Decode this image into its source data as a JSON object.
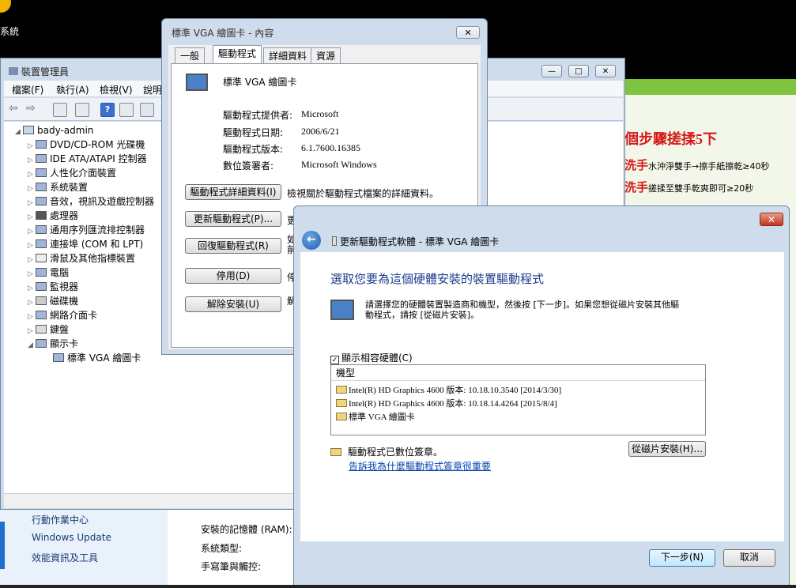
{
  "desktop": {
    "label": "系統"
  },
  "green_app": {
    "title": "個步驟搓揉5下",
    "line1_prefix": "洗手",
    "line1": "水沖淨雙手→擦手紙擦乾≥40秒",
    "line2_prefix": "洗手",
    "line2": "搓揉至雙手乾爽即可≥20秒"
  },
  "control_panel": {
    "links": [
      "行動作業中心",
      "Windows Update",
      "效能資訊及工具"
    ],
    "props": [
      "安裝的記憶體 (RAM):",
      "系統類型:",
      "手寫筆與觸控:"
    ]
  },
  "device_manager": {
    "title": "裝置管理員",
    "menu": [
      "檔案(F)",
      "執行(A)",
      "檢視(V)",
      "說明"
    ],
    "root": "bady-admin",
    "categories": [
      "DVD/CD-ROM 光碟機",
      "IDE ATA/ATAPI 控制器",
      "人性化介面裝置",
      "系統裝置",
      "音效，視訊及遊戲控制器",
      "處理器",
      "通用序列匯流排控制器",
      "連接埠 (COM 和 LPT)",
      "滑鼠及其他指標裝置",
      "電腦",
      "監視器",
      "磁碟機",
      "網路介面卡",
      "鍵盤",
      "顯示卡"
    ],
    "display_child": "標準 VGA 繪圖卡"
  },
  "properties": {
    "title": "標準 VGA 繪圖卡 - 內容",
    "tabs": [
      "一般",
      "驅動程式",
      "詳細資料",
      "資源"
    ],
    "device_name": "標準 VGA 繪圖卡",
    "info": [
      {
        "k": "驅動程式提供者:",
        "v": "Microsoft"
      },
      {
        "k": "驅動程式日期:",
        "v": "2006/6/21"
      },
      {
        "k": "驅動程式版本:",
        "v": "6.1.7600.16385"
      },
      {
        "k": "數位簽署者:",
        "v": "Microsoft Windows"
      }
    ],
    "buttons": [
      {
        "label": "驅動程式詳細資料(I)",
        "desc": "檢視關於驅動程式檔案的詳細資料。"
      },
      {
        "label": "更新驅動程式(P)...",
        "desc": "更"
      },
      {
        "label": "回復驅動程式(R)",
        "desc": "如\n前"
      },
      {
        "label": "停用(D)",
        "desc": "停"
      },
      {
        "label": "解除安裝(U)",
        "desc": "解"
      }
    ]
  },
  "wizard": {
    "title": "更新驅動程式軟體 - 標準 VGA 繪圖卡",
    "heading": "選取您要為這個硬體安裝的裝置驅動程式",
    "desc1": "請選擇您的硬體裝置製造商和機型，然後按 [下一步]。如果您想從磁片安裝其他驅",
    "desc2": "動程式，請按 [從磁片安裝]。",
    "show_compatible": "顯示相容硬體(C)",
    "list_header": "機型",
    "models": [
      "Intel(R) HD Graphics 4600 版本: 10.18.10.3540 [2014/3/30]",
      "Intel(R) HD Graphics 4600 版本: 10.18.14.4264 [2015/8/4]",
      "標準 VGA 繪圖卡"
    ],
    "signed": "驅動程式已數位簽章。",
    "why_link": "告訴我為什麼驅動程式簽章很重要",
    "have_disk": "從磁片安裝(H)...",
    "next": "下一步(N)",
    "cancel": "取消"
  }
}
